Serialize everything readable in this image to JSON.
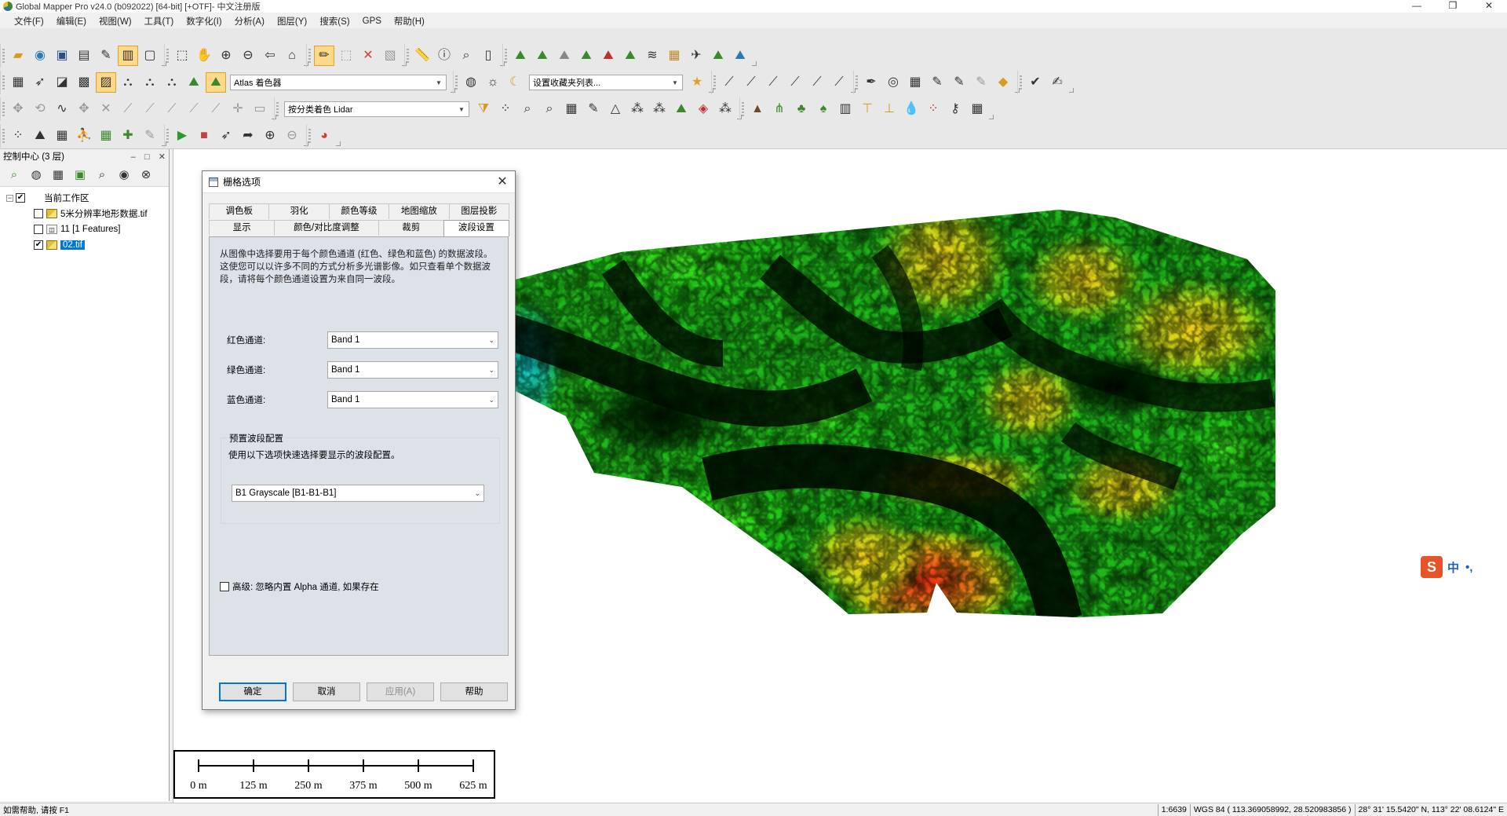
{
  "window": {
    "title": "Global Mapper Pro v24.0 (b092022) [64-bit] [+OTF]- 中文注册版",
    "controls": [
      "—",
      "❐",
      "✕"
    ]
  },
  "menu": [
    "文件(F)",
    "编辑(E)",
    "视图(W)",
    "工具(T)",
    "数字化(I)",
    "分析(A)",
    "图层(Y)",
    "搜索(S)",
    "GPS",
    "帮助(H)"
  ],
  "toolbar": {
    "shader_combo": "Atlas 着色器",
    "favorites_combo": "设置收藏夹列表...",
    "lidar_combo": "按分类着色 Lidar"
  },
  "control_center": {
    "title": "控制中心 (3 层)",
    "header_buttons": [
      "–",
      "□",
      "✕"
    ],
    "workspace_label": "当前工作区",
    "layers": [
      {
        "label": "5米分辨率地形数据.tif",
        "checked": false,
        "type": "raster"
      },
      {
        "label": "11 [1 Features]",
        "checked": false,
        "type": "vector"
      },
      {
        "label": "02.tif",
        "checked": true,
        "type": "raster",
        "selected": true
      }
    ]
  },
  "dialog": {
    "title": "栅格选项",
    "tabs_row1": [
      "调色板",
      "羽化",
      "颜色等级",
      "地图缩放",
      "图层投影"
    ],
    "tabs_row2": [
      "显示",
      "颜色/对比度调整",
      "裁剪",
      "波段设置"
    ],
    "active_tab": "波段设置",
    "description": "从图像中选择要用于每个颜色通道 (红色、绿色和蓝色) 的数据波段。这使您可以以许多不同的方式分析多光谱影像。如只查看单个数据波段，请将每个颜色通道设置为来自同一波段。",
    "channels": [
      {
        "label": "红色通道:",
        "value": "Band 1"
      },
      {
        "label": "绿色通道:",
        "value": "Band 1"
      },
      {
        "label": "蓝色通道:",
        "value": "Band 1"
      }
    ],
    "preset_title": "预置波段配置",
    "preset_hint": "使用以下选项快速选择要显示的波段配置。",
    "preset_value": "B1 Grayscale [B1-B1-B1]",
    "advanced_label": "高级: 忽略内置 Alpha 通道, 如果存在",
    "advanced_checked": false,
    "buttons": {
      "ok": "确定",
      "cancel": "取消",
      "apply": "应用(A)",
      "help": "帮助"
    }
  },
  "scalebar": {
    "labels": [
      "0 m",
      "125 m",
      "250 m",
      "375 m",
      "500 m",
      "625 m"
    ]
  },
  "ime": {
    "logo": "S",
    "lang": "中",
    "punc": "•,"
  },
  "status": {
    "help": "如需帮助, 请按 F1",
    "scale": "1:6639",
    "coords": "WGS 84 ( 113.369058992, 28.520983856 )",
    "dms": "28° 31' 15.5420\" N, 113° 22' 08.6124\" E"
  },
  "colors": {
    "accent": "#0078d7",
    "terrain_low": "#00b8d0",
    "terrain_mid": "#2ee01a",
    "terrain_high": "#e8d010",
    "terrain_peak": "#e83010"
  }
}
